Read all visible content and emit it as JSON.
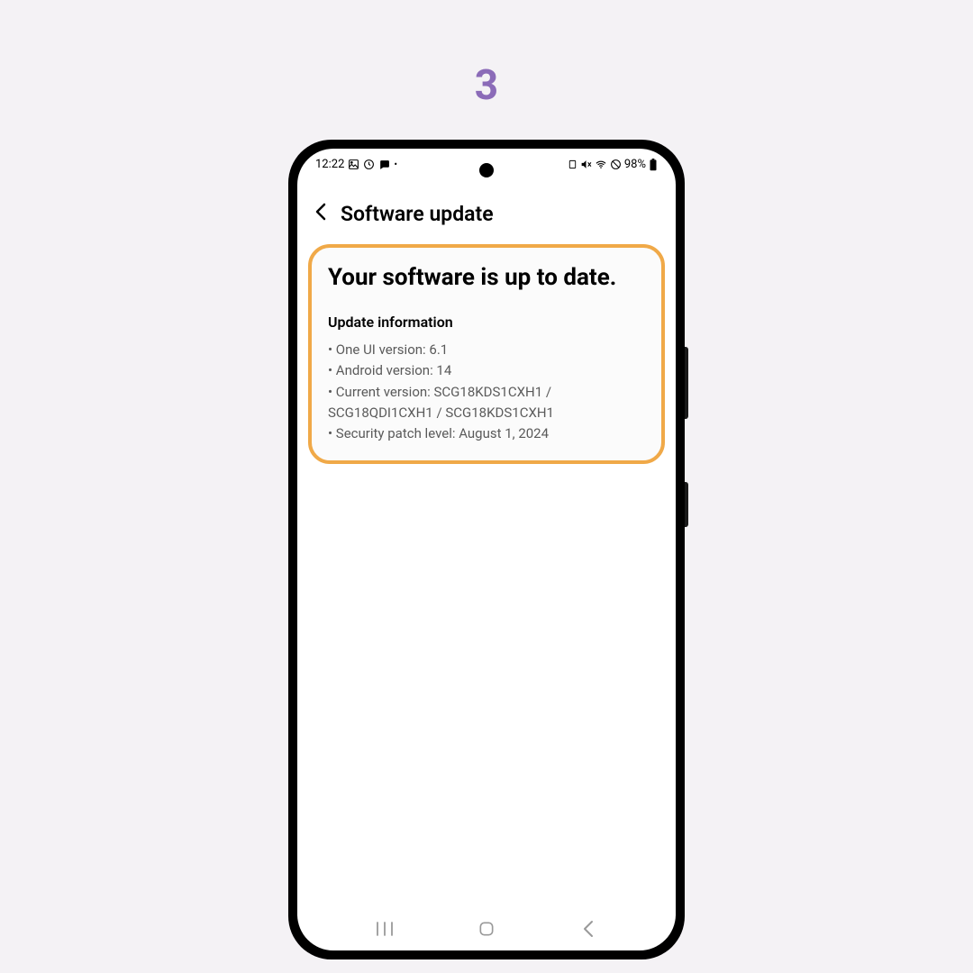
{
  "step": "3",
  "statusBar": {
    "time": "12:22",
    "battery": "98%"
  },
  "header": {
    "title": "Software update"
  },
  "main": {
    "statusText": "Your software is up to date.",
    "infoTitle": "Update information",
    "items": [
      "One UI version: 6.1",
      "Android version: 14",
      "Current version: SCG18KDS1CXH1 / SCG18QDI1CXH1 / SCG18KDS1CXH1",
      "Security patch level: August 1, 2024"
    ]
  }
}
